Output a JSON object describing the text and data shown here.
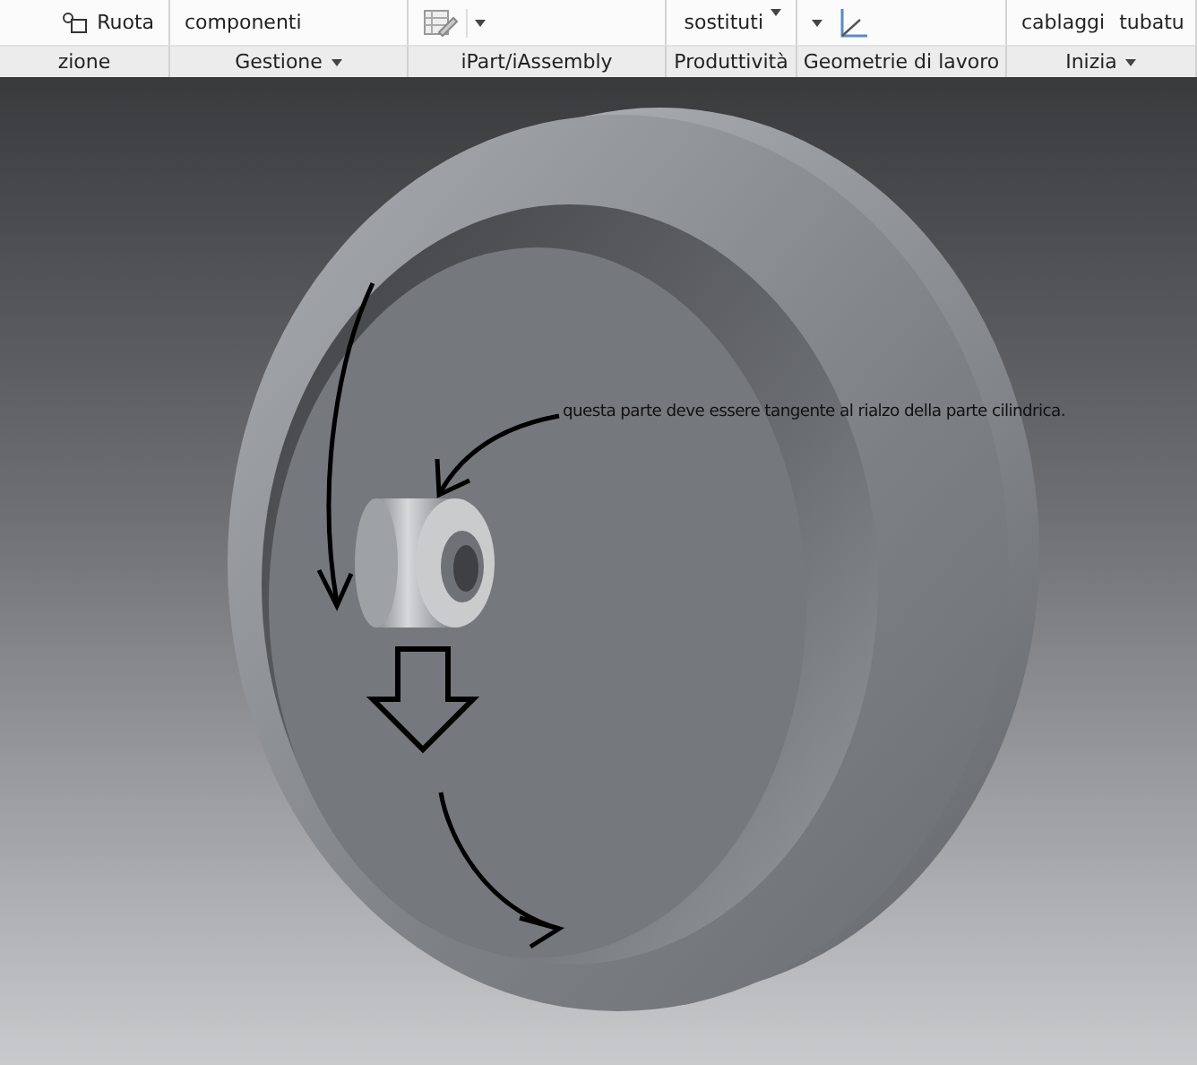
{
  "ribbon": {
    "panels": [
      {
        "label": "zione",
        "menu": false,
        "tools": [
          {
            "kind": "rotate",
            "label": "Ruota"
          }
        ]
      },
      {
        "label": "Gestione",
        "menu": true,
        "tools": [
          {
            "kind": "text",
            "label": "componenti"
          }
        ]
      },
      {
        "label": "iPart/iAssembly",
        "menu": false,
        "tools": [
          {
            "kind": "table"
          }
        ]
      },
      {
        "label": "Produttività",
        "menu": false,
        "tools": [
          {
            "kind": "text-caret",
            "label": "sostituti"
          }
        ]
      },
      {
        "label": "Geometrie di lavoro",
        "menu": false,
        "tools": [
          {
            "kind": "caret"
          },
          {
            "kind": "axes"
          }
        ]
      },
      {
        "label": "Inizia",
        "menu": true,
        "tools": [
          {
            "kind": "text",
            "label": "cablaggi"
          },
          {
            "kind": "text",
            "label": "tubatu"
          }
        ]
      }
    ]
  },
  "viewport": {
    "note": "questa parte deve essere tangente al rialzo della parte cilindrica."
  }
}
